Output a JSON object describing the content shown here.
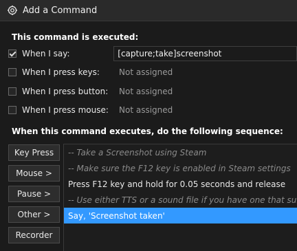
{
  "window": {
    "title": "Add a Command"
  },
  "trigger_section": {
    "heading": "This command is executed:",
    "rows": [
      {
        "label": "When I say:",
        "checked": true,
        "value": "[capture;take]screenshot"
      },
      {
        "label": "When I press keys:",
        "checked": false,
        "value": "Not assigned"
      },
      {
        "label": "When I press button:",
        "checked": false,
        "value": "Not assigned"
      },
      {
        "label": "When I press mouse:",
        "checked": false,
        "value": "Not assigned"
      }
    ]
  },
  "sequence_section": {
    "heading": "When this command executes, do the following sequence:",
    "buttons": [
      "Key Press",
      "Mouse >",
      "Pause >",
      "Other >",
      "Recorder"
    ],
    "items": [
      {
        "text": "-- Take a Screenshot using Steam",
        "type": "comment"
      },
      {
        "text": "-- Make sure the F12 key is enabled in Steam settings",
        "type": "comment"
      },
      {
        "text": "Press F12 key and hold for 0.05 seconds and release",
        "type": "action"
      },
      {
        "text": "-- Use either TTS or a sound file if you have one that suits",
        "type": "comment"
      },
      {
        "text": "Say, 'Screenshot taken'",
        "type": "selected"
      }
    ]
  },
  "colors": {
    "selection": "#3399ff",
    "background": "#1b1b1b"
  }
}
